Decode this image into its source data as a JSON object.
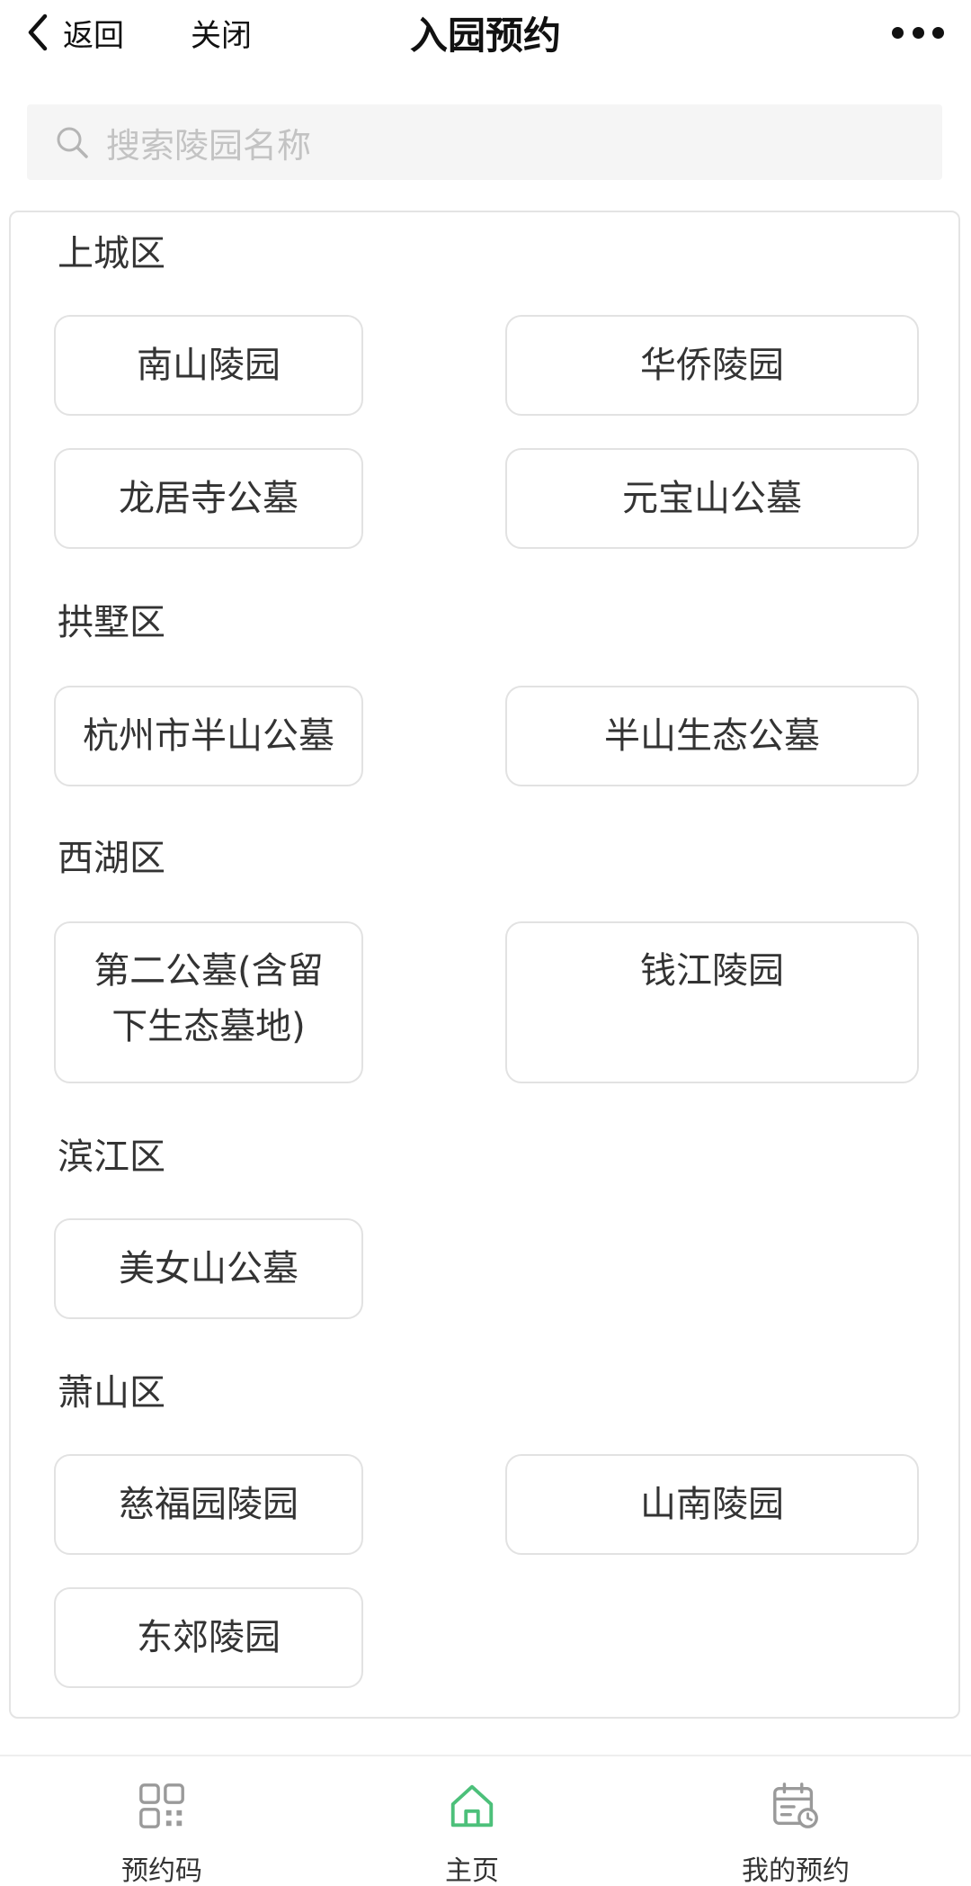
{
  "nav": {
    "back_label": "返回",
    "close_label": "关闭",
    "title": "入园预约"
  },
  "search": {
    "placeholder": "搜索陵园名称"
  },
  "districts": [
    {
      "name": "上城区",
      "items": [
        "南山陵园",
        "华侨陵园",
        "龙居寺公墓",
        "元宝山公墓"
      ]
    },
    {
      "name": "拱墅区",
      "items": [
        "杭州市半山公墓",
        "半山生态公墓"
      ]
    },
    {
      "name": "西湖区",
      "items": [
        "第二公墓(含留下生态墓地)",
        "钱江陵园"
      ]
    },
    {
      "name": "滨江区",
      "items": [
        "美女山公墓"
      ]
    },
    {
      "name": "萧山区",
      "items": [
        "慈福园陵园",
        "山南陵园",
        "东郊陵园"
      ]
    }
  ],
  "tabbar": {
    "items": [
      {
        "label": "预约码",
        "icon": "qr-code-icon",
        "active": false
      },
      {
        "label": "主页",
        "icon": "home-icon",
        "active": true
      },
      {
        "label": "我的预约",
        "icon": "calendar-icon",
        "active": false
      }
    ]
  },
  "colors": {
    "accent_green": "#4cc07a",
    "icon_gray": "#9a9a9a",
    "placeholder_gray": "#c3c3c3"
  }
}
